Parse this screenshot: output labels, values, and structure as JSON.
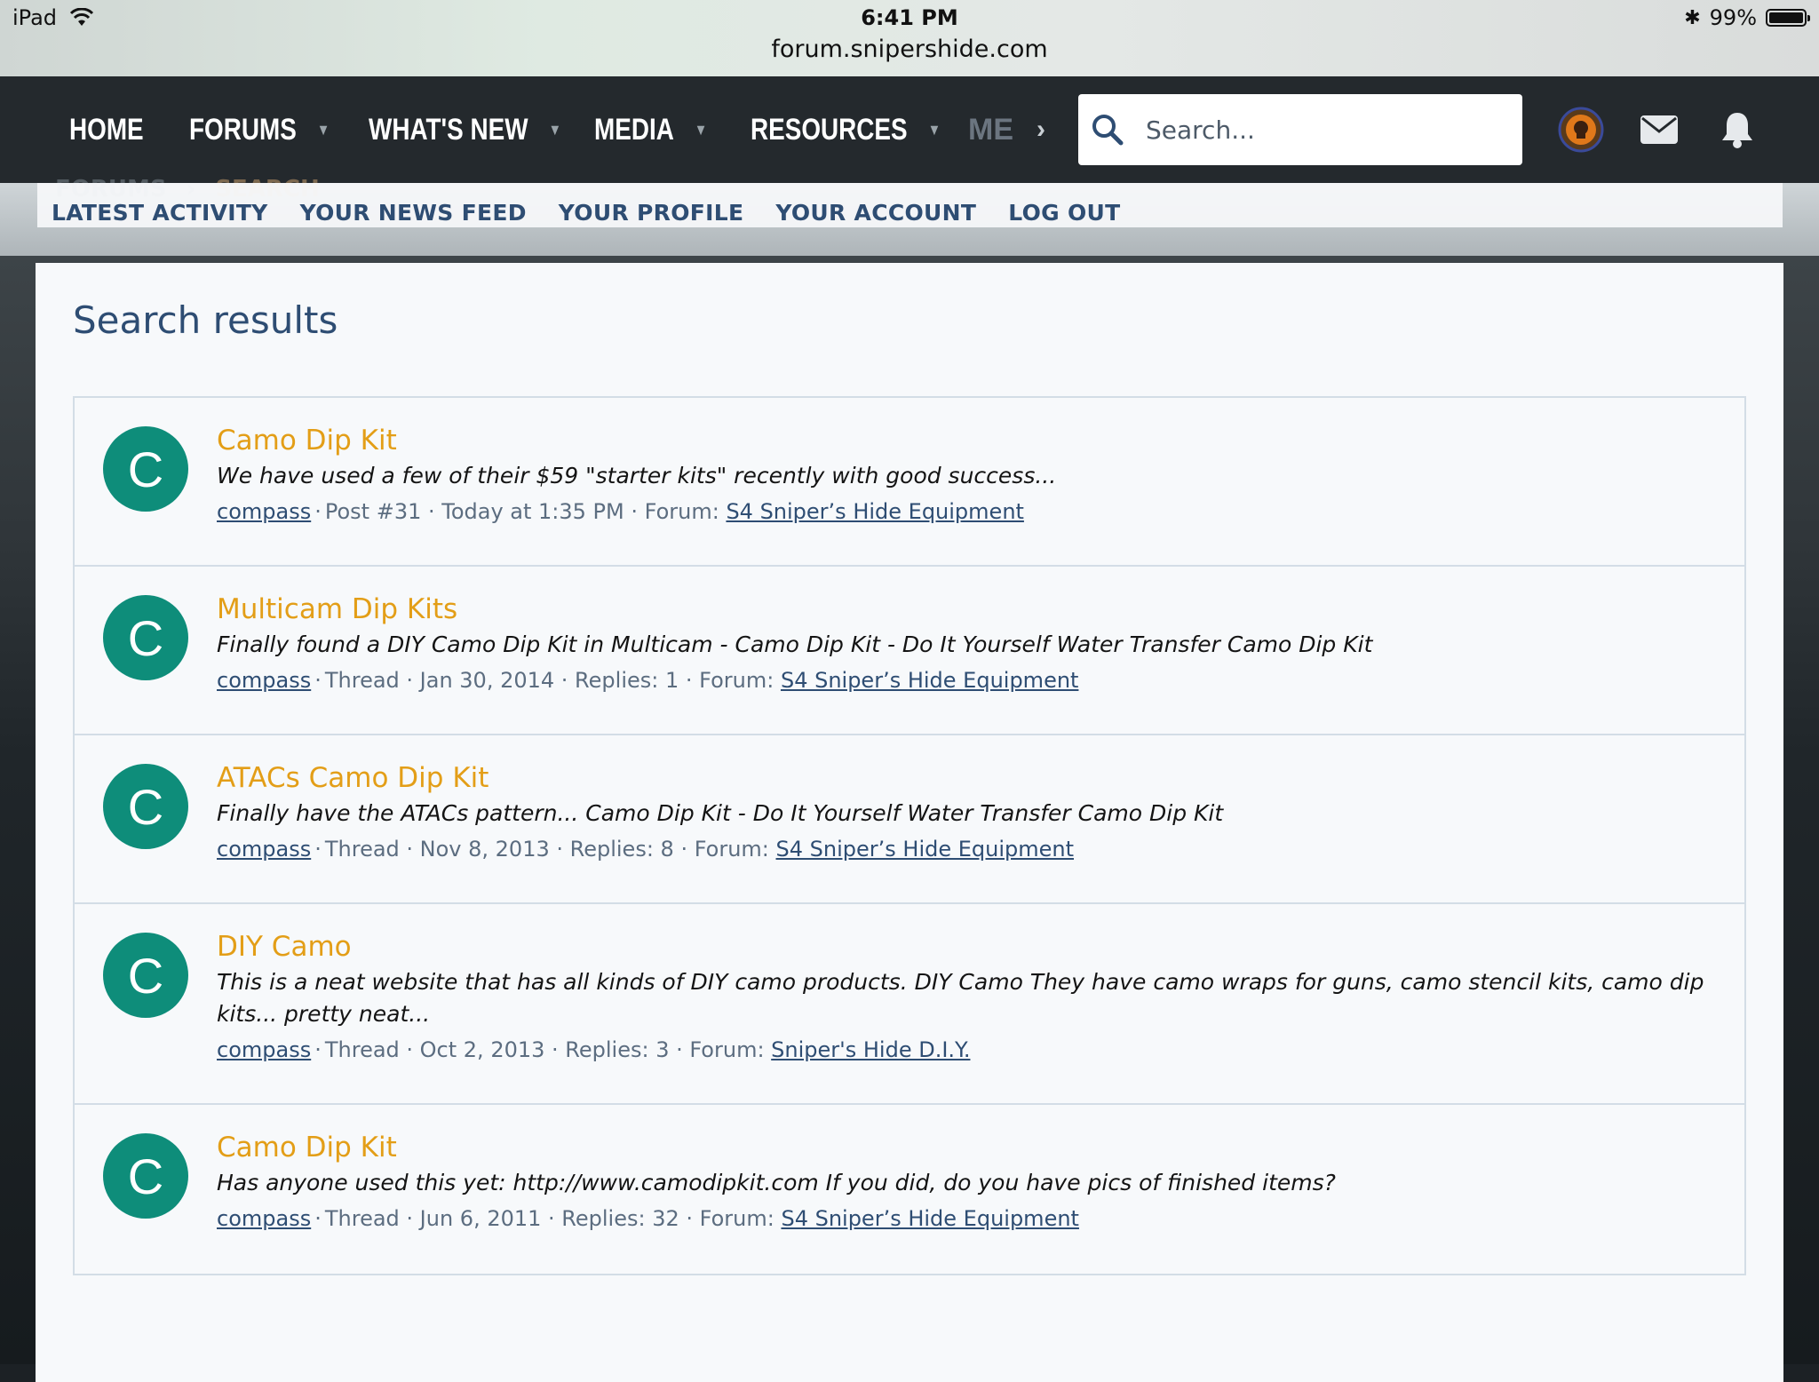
{
  "status_bar": {
    "device": "iPad",
    "time": "6:41 PM",
    "url": "forum.snipershide.com",
    "battery": "99%",
    "battery_level": 0.99
  },
  "nav": {
    "items": [
      {
        "label": "HOME",
        "has_caret": false
      },
      {
        "label": "FORUMS",
        "has_caret": true
      },
      {
        "label": "WHAT'S NEW",
        "has_caret": true
      },
      {
        "label": "MEDIA",
        "has_caret": true
      },
      {
        "label": "RESOURCES",
        "has_caret": true
      }
    ],
    "more_label": "ME",
    "search_placeholder": "Search..."
  },
  "breadcrumb": {
    "items": [
      "FORUMS",
      "SEARCH"
    ]
  },
  "subnav": {
    "items": [
      "LATEST ACTIVITY",
      "YOUR NEWS FEED",
      "YOUR PROFILE",
      "YOUR ACCOUNT",
      "LOG OUT"
    ]
  },
  "page_title": "Search results",
  "results": [
    {
      "avatar_letter": "C",
      "title": "Camo Dip Kit",
      "snippet": "We have used a few of their $59 \"starter kits\" recently with good success...",
      "author": "compass",
      "meta": "Post #31 · Today at 1:35 PM · Forum:",
      "forum": "S4 Sniper’s Hide Equipment"
    },
    {
      "avatar_letter": "C",
      "title": "Multicam Dip Kits",
      "snippet": "Finally found a DIY Camo Dip Kit in Multicam - Camo Dip Kit - Do It Yourself Water Transfer Camo Dip Kit",
      "author": "compass",
      "meta": "Thread · Jan 30, 2014 · Replies: 1 · Forum:",
      "forum": "S4 Sniper’s Hide Equipment"
    },
    {
      "avatar_letter": "C",
      "title": "ATACs Camo Dip Kit",
      "snippet": "Finally have the ATACs pattern... Camo Dip Kit - Do It Yourself Water Transfer Camo Dip Kit",
      "author": "compass",
      "meta": "Thread · Nov 8, 2013 · Replies: 8 · Forum:",
      "forum": "S4 Sniper’s Hide Equipment"
    },
    {
      "avatar_letter": "C",
      "title": "DIY Camo",
      "snippet": "This is a neat website that has all kinds of DIY camo products. DIY Camo They have camo wraps for guns, camo stencil kits, camo dip kits... pretty neat...",
      "author": "compass",
      "meta": "Thread · Oct 2, 2013 · Replies: 3 · Forum:",
      "forum": "Sniper's Hide D.I.Y."
    },
    {
      "avatar_letter": "C",
      "title": "Camo Dip Kit",
      "snippet": "Has anyone used this yet: http://www.camodipkit.com If you did, do you have pics of finished items?",
      "author": "compass",
      "meta": "Thread · Jun 6, 2011 · Replies: 32 · Forum:",
      "forum": "S4 Sniper’s Hide Equipment"
    }
  ],
  "colors": {
    "accent_title": "#e39e17",
    "link": "#2e4d73",
    "avatar": "#0e8d7a",
    "nav_bg": "#24292d"
  }
}
